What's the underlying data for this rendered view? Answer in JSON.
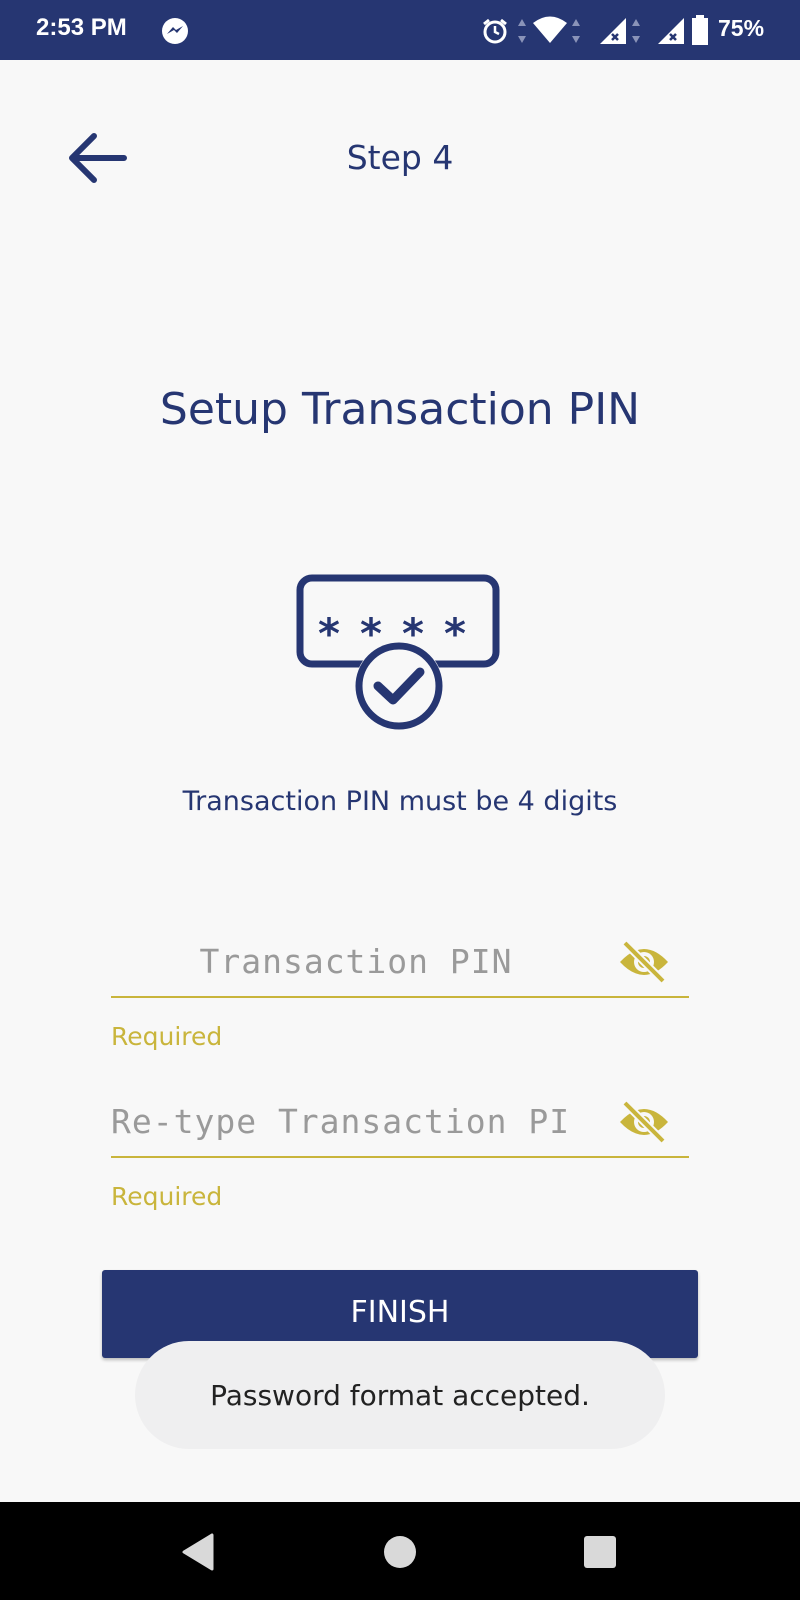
{
  "status_bar": {
    "time": "2:53 PM",
    "battery": "75%",
    "icons": [
      "messenger-icon",
      "alarm-icon",
      "wifi-icon",
      "signal-icon",
      "signal-icon",
      "battery-icon"
    ]
  },
  "header": {
    "back_icon": "arrow-left-icon",
    "step_title": "Step 4"
  },
  "main": {
    "heading": "Setup Transaction PIN",
    "illustration_icon": "pin-check-icon",
    "hint": "Transaction PIN must be 4 digits",
    "pin_field": {
      "placeholder": "Transaction PIN",
      "value": "",
      "helper": "Required",
      "toggle_icon": "eye-off-icon"
    },
    "retype_field": {
      "placeholder": "Re-type Transaction PI",
      "value": "",
      "helper": "Required",
      "toggle_icon": "eye-off-icon"
    },
    "finish_label": "FINISH"
  },
  "toast": {
    "message": "Password format accepted."
  },
  "nav_bar": {
    "items": [
      "back-triangle-icon",
      "home-circle-icon",
      "recents-square-icon"
    ]
  },
  "colors": {
    "primary": "#263672",
    "accent": "#c9b53c",
    "background": "#f8f8f8",
    "toast_bg": "#efeff0"
  }
}
